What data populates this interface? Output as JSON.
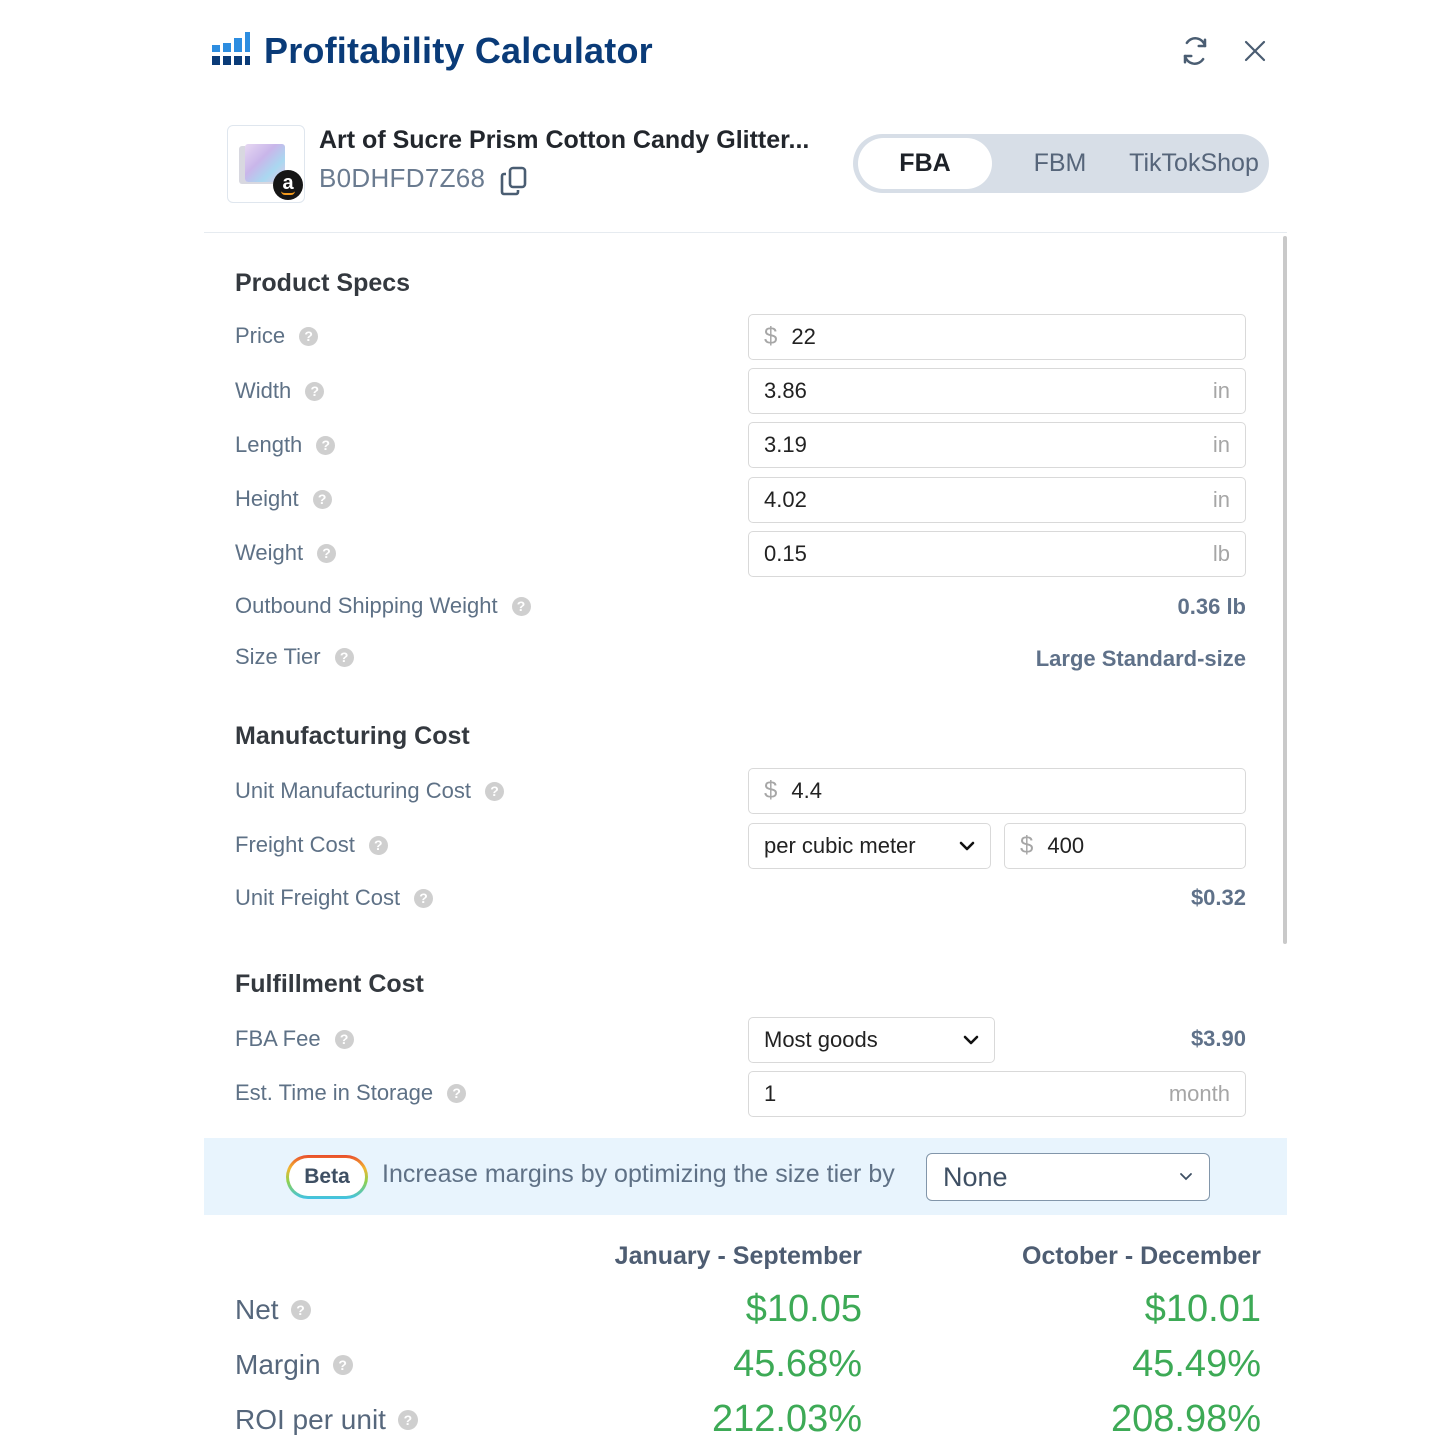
{
  "header": {
    "title": "Profitability Calculator",
    "logo_icon": "bar-chart-icon",
    "refresh_icon": "refresh-icon",
    "close_icon": "close-icon"
  },
  "product": {
    "name": "Art of Sucre Prism Cotton Candy Glitter...",
    "asin": "B0DHFD7Z68",
    "marketplace_badge": "a",
    "copy_icon": "copy-icon"
  },
  "fulfillment_tabs": [
    {
      "label": "FBA",
      "active": true
    },
    {
      "label": "FBM",
      "active": false
    },
    {
      "label": "TikTokShop",
      "active": false
    }
  ],
  "product_specs": {
    "title": "Product Specs",
    "price": {
      "label": "Price",
      "currency": "$",
      "value": "22"
    },
    "width": {
      "label": "Width",
      "value": "3.86",
      "unit": "in"
    },
    "length": {
      "label": "Length",
      "value": "3.19",
      "unit": "in"
    },
    "height": {
      "label": "Height",
      "value": "4.02",
      "unit": "in"
    },
    "weight": {
      "label": "Weight",
      "value": "0.15",
      "unit": "lb"
    },
    "outbound_shipping_weight": {
      "label": "Outbound Shipping Weight",
      "value": "0.36 lb"
    },
    "size_tier": {
      "label": "Size Tier",
      "value": "Large Standard-size"
    }
  },
  "manufacturing_cost": {
    "title": "Manufacturing Cost",
    "unit_cost": {
      "label": "Unit Manufacturing Cost",
      "currency": "$",
      "value": "4.4"
    },
    "freight_cost": {
      "label": "Freight Cost",
      "basis": "per cubic meter",
      "currency": "$",
      "value": "400"
    },
    "unit_freight_cost": {
      "label": "Unit Freight Cost",
      "value": "$0.32"
    }
  },
  "fulfillment_cost": {
    "title": "Fulfillment Cost",
    "fba_fee": {
      "label": "FBA Fee",
      "category": "Most goods",
      "value": "$3.90"
    },
    "storage_time": {
      "label": "Est. Time in Storage",
      "value": "1",
      "unit": "month"
    }
  },
  "beta_bar": {
    "badge": "Beta",
    "text": "Increase margins by optimizing the size tier by",
    "selected": "None"
  },
  "summary": {
    "columns": [
      "January - September",
      "October - December"
    ],
    "rows": [
      {
        "label": "Net",
        "values": [
          "$10.05",
          "$10.01"
        ]
      },
      {
        "label": "Margin",
        "values": [
          "45.68%",
          "45.49%"
        ]
      },
      {
        "label": "ROI per unit",
        "values": [
          "212.03%",
          "208.98%"
        ]
      }
    ],
    "positive_color": "#3daa56"
  },
  "help_glyph": "?"
}
